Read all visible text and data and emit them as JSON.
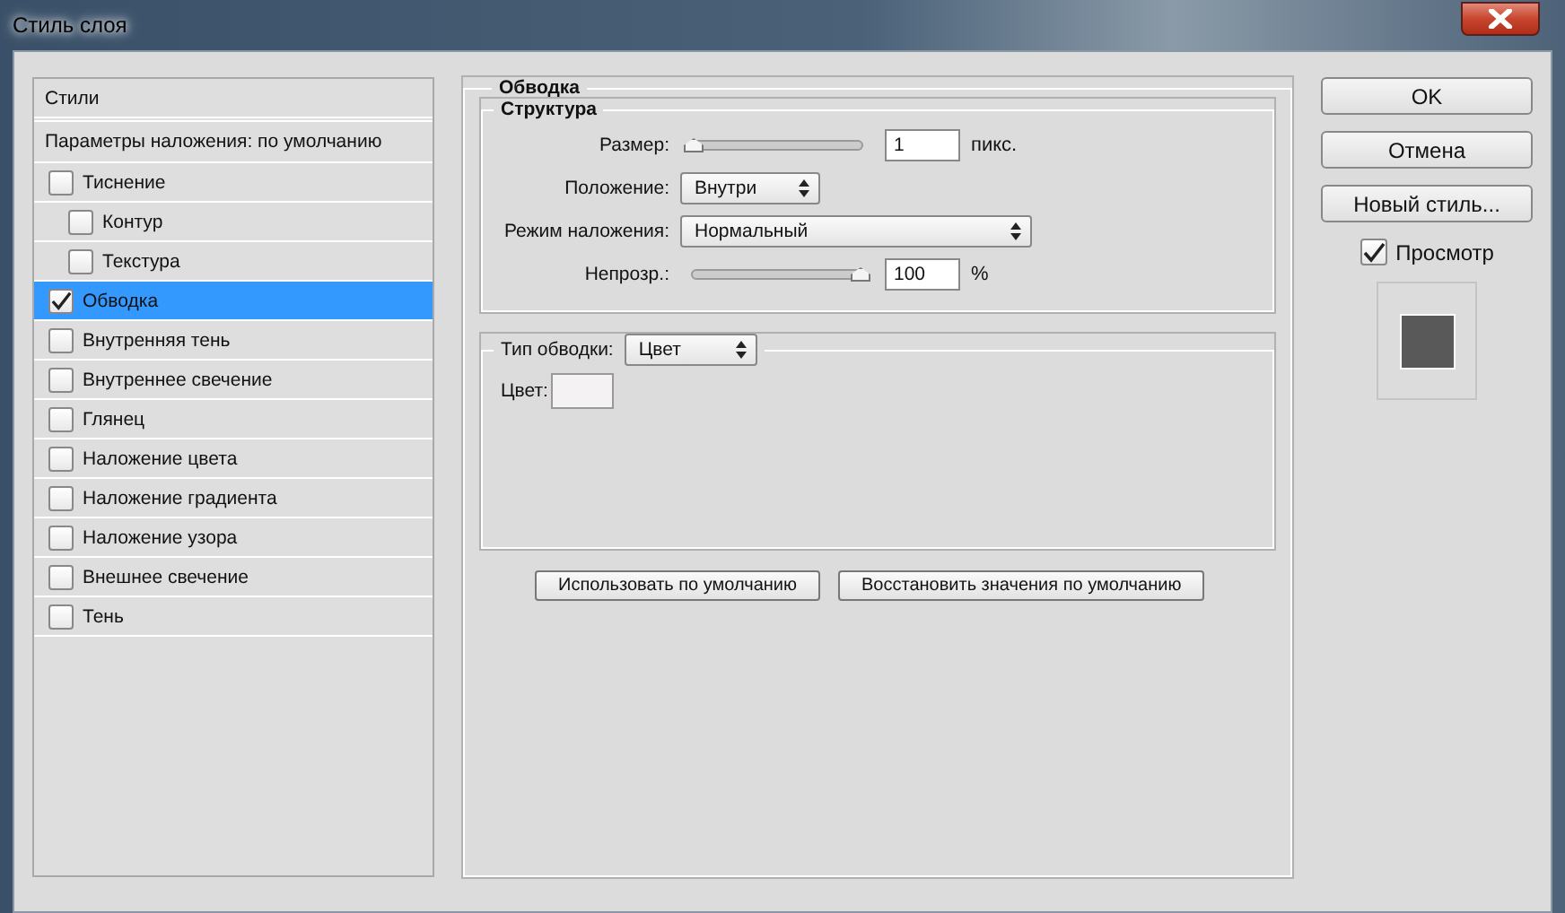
{
  "window": {
    "title": "Стиль слоя"
  },
  "styles": {
    "header": "Стили",
    "blending": "Параметры наложения: по умолчанию",
    "items": [
      {
        "label": "Тиснение",
        "checked": false,
        "selected": false,
        "children": [
          {
            "label": "Контур",
            "checked": false,
            "selected": false
          },
          {
            "label": "Текстура",
            "checked": false,
            "selected": false
          }
        ]
      },
      {
        "label": "Обводка",
        "checked": true,
        "selected": true
      },
      {
        "label": "Внутренняя тень",
        "checked": false,
        "selected": false
      },
      {
        "label": "Внутреннее свечение",
        "checked": false,
        "selected": false
      },
      {
        "label": "Глянец",
        "checked": false,
        "selected": false
      },
      {
        "label": "Наложение цвета",
        "checked": false,
        "selected": false
      },
      {
        "label": "Наложение градиента",
        "checked": false,
        "selected": false
      },
      {
        "label": "Наложение узора",
        "checked": false,
        "selected": false
      },
      {
        "label": "Внешнее свечение",
        "checked": false,
        "selected": false
      },
      {
        "label": "Тень",
        "checked": false,
        "selected": false
      }
    ]
  },
  "stroke": {
    "title": "Обводка",
    "structure": {
      "title": "Структура",
      "size": {
        "label": "Размер:",
        "level": 0,
        "value": "1",
        "unit": "пикс."
      },
      "position": {
        "label": "Положение:",
        "value": "Внутри"
      },
      "blend_mode": {
        "label": "Режим наложения:",
        "value": "Нормальный"
      },
      "opacity": {
        "label": "Непрозр.:",
        "level": 1,
        "value": "100",
        "unit": "%"
      }
    },
    "fill_type": {
      "label": "Тип обводки:",
      "value": "Цвет"
    },
    "color": {
      "label": "Цвет:",
      "color": "#f4f2f2"
    },
    "buttons": [
      "Использовать по умолчанию",
      "Восстановить значения по умолчанию"
    ]
  },
  "actions": [
    "OK",
    "Отмена",
    "Новый стиль..."
  ],
  "preview": {
    "label": "Просмотр",
    "checked": true
  }
}
